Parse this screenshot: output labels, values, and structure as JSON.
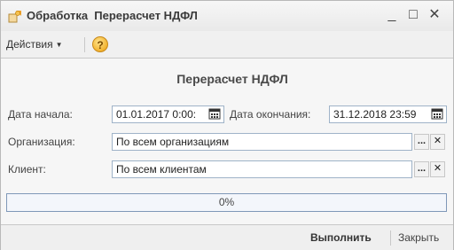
{
  "window": {
    "title": "Обработка  Перерасчет НДФЛ",
    "minimize": "_",
    "maximize": "□",
    "close": "✕"
  },
  "toolbar": {
    "actions_label": "Действия",
    "help_label": "?"
  },
  "form": {
    "heading": "Перерасчет НДФЛ",
    "start_label": "Дата начала:",
    "start_value": "01.01.2017  0:00:",
    "end_label": "Дата окончания:",
    "end_value": "31.12.2018 23:59",
    "org_label": "Организация:",
    "org_value": "По всем организациям",
    "client_label": "Клиент:",
    "client_value": "По всем клиентам",
    "ellipsis": "...",
    "clear": "✕"
  },
  "progress": {
    "text": "0%",
    "value": 0
  },
  "footer": {
    "run_label": "Выполнить",
    "close_label": "Закрыть"
  },
  "icons": [
    "app-icon",
    "chevron-down-icon",
    "help-icon",
    "calendar-icon",
    "ellipsis-icon",
    "clear-icon"
  ]
}
